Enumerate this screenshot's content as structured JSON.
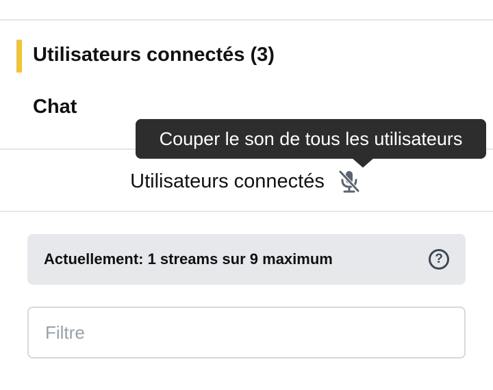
{
  "tabs": [
    {
      "label": "Utilisateurs connectés (3)",
      "active": true
    },
    {
      "label": "Chat",
      "active": false
    }
  ],
  "accent_color": "#f4c430",
  "tooltip": {
    "text": "Couper le son de tous les utilisateurs"
  },
  "section": {
    "title": "Utilisateurs connectés",
    "mute_all_icon": "microphone-muted-icon"
  },
  "info": {
    "text": "Actuellement: 1 streams sur 9 maximum",
    "help_icon": "question-circle-icon",
    "help_glyph": "?"
  },
  "filter": {
    "placeholder": "Filtre",
    "value": ""
  }
}
